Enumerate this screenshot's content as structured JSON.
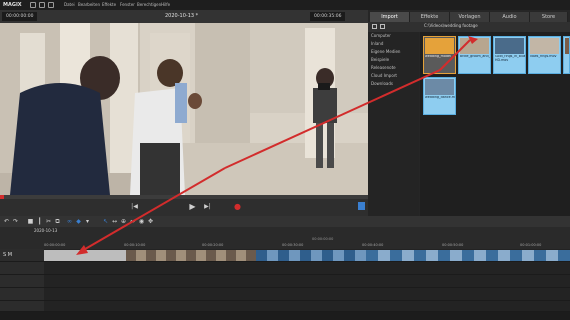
{
  "app": {
    "logo": "MAGIX",
    "menu": [
      "Datei",
      "Bearbeiten",
      "Effekte",
      "Fenster",
      "Berechtigen",
      "Hilfe"
    ]
  },
  "preview": {
    "timecode_left": "00:00:00:00",
    "title": "2020-10-13 *",
    "timecode_right": "00:00:35:06"
  },
  "controls": {
    "prev": "|◀",
    "play": "▶",
    "next": "▶|",
    "record": "●"
  },
  "media": {
    "tabs": [
      "Import",
      "Effekte",
      "Vorlagen",
      "Audio",
      "Store"
    ],
    "path": "C:\\Videos\\wedding footage",
    "tree": [
      "Computer",
      "Inland",
      "Eigene Medien",
      "Beispiele",
      "Releasenote",
      "Cloud Import",
      "Downloads"
    ],
    "items": [
      {
        "name": "wedding_model",
        "type": "folder"
      },
      {
        "name": "bride_groom_and_wedding_guests_at_church_door_2",
        "type": "video"
      },
      {
        "name": "Gold_rings_in_blue_boxes_on_table_ZoomEspocal_Schwandt_FHD_H264-HD.mov",
        "type": "video"
      },
      {
        "name": "vows_rings.mov",
        "type": "video"
      },
      {
        "name": "wedding_dance.mov",
        "type": "video"
      }
    ]
  },
  "timeline": {
    "date_label": "2020-10-13",
    "track_label": "S M",
    "ruler_marks": [
      "00:00:00:00",
      "00:00:10:00",
      "00:00:20:00",
      "00:00:30:00",
      "00:00:40:00",
      "00:00:50:00",
      "00:01:00:00",
      "00:01:10:00"
    ],
    "playhead": "00:00:00:00"
  },
  "colors": {
    "accent": "#d22c2c",
    "selected_thumb": "#8ecdf0",
    "folder": "#e5a23a",
    "active_tab": "#4a4a4a"
  }
}
